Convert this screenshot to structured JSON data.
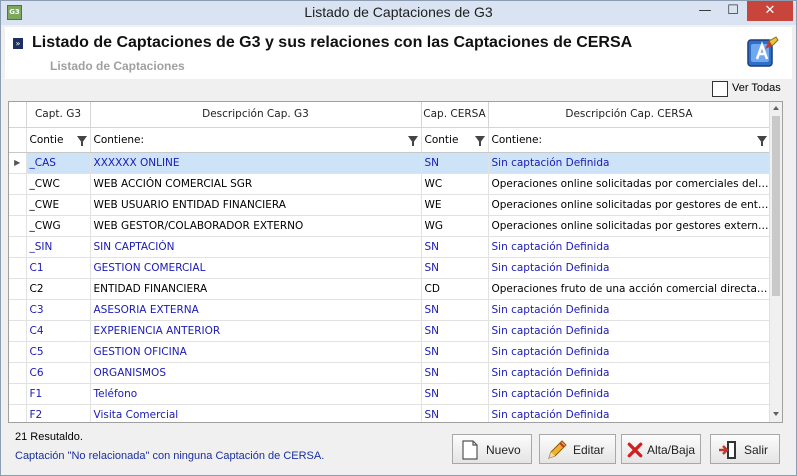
{
  "window": {
    "title": "Listado de Captaciones de G3",
    "app_icon_text": "G3",
    "min_symbol": "—",
    "max_symbol": "☐",
    "close_symbol": "✕"
  },
  "header": {
    "title": "Listado de  Captaciones de G3 y sus relaciones con las Captaciones de CERSA",
    "subtitle": "Listado de Captaciones",
    "arrow_symbol": "»"
  },
  "toggle": {
    "label": "Ver Todas",
    "checked": false
  },
  "grid": {
    "columns": [
      "Capt. G3",
      "Descripción Cap. G3",
      "Cap. CERSA",
      "Descripción Cap. CERSA"
    ],
    "filters": [
      "Contie",
      "Contiene:",
      "Contie",
      "Contiene:"
    ],
    "selected_indicator": "▶",
    "rows": [
      {
        "g3": "_CAS",
        "desc": "XXXXXX ONLINE",
        "cersa": "SN",
        "cdesc": "Sin captación Definida",
        "blue": true,
        "selected": true
      },
      {
        "g3": "_CWC",
        "desc": "WEB ACCIÓN COMERCIAL SGR",
        "cersa": "WC",
        "cdesc": "Operaciones online solicitadas por comerciales del C...",
        "blue": false
      },
      {
        "g3": "_CWE",
        "desc": "WEB USUARIO ENTIDAD FINANCIERA",
        "cersa": "WE",
        "cdesc": "Operaciones online solicitadas  por gestores de entid...",
        "blue": false
      },
      {
        "g3": "_CWG",
        "desc": "WEB GESTOR/COLABORADOR EXTERNO",
        "cersa": "WG",
        "cdesc": "Operaciones online solicitadas por gestores externos...",
        "blue": false
      },
      {
        "g3": "_SIN",
        "desc": "SIN CAPTACIÓN",
        "cersa": "SN",
        "cdesc": "Sin captación Definida",
        "blue": true
      },
      {
        "g3": "C1",
        "desc": "GESTION COMERCIAL",
        "cersa": "SN",
        "cdesc": "Sin captación Definida",
        "blue": true
      },
      {
        "g3": "C2",
        "desc": "ENTIDAD FINANCIERA",
        "cersa": "CD",
        "cdesc": "Operaciones fruto de una acción comercial directa p...",
        "blue": false
      },
      {
        "g3": "C3",
        "desc": "ASESORIA EXTERNA",
        "cersa": "SN",
        "cdesc": "Sin captación Definida",
        "blue": true
      },
      {
        "g3": "C4",
        "desc": "EXPERIENCIA ANTERIOR",
        "cersa": "SN",
        "cdesc": "Sin captación Definida",
        "blue": true
      },
      {
        "g3": "C5",
        "desc": "GESTION OFICINA",
        "cersa": "SN",
        "cdesc": "Sin captación Definida",
        "blue": true
      },
      {
        "g3": "C6",
        "desc": "ORGANISMOS",
        "cersa": "SN",
        "cdesc": "Sin captación Definida",
        "blue": true
      },
      {
        "g3": "F1",
        "desc": "Teléfono",
        "cersa": "SN",
        "cdesc": "Sin captación Definida",
        "blue": true
      },
      {
        "g3": "F2",
        "desc": "Visita Comercial",
        "cersa": "SN",
        "cdesc": "Sin captación Definida",
        "blue": true
      }
    ]
  },
  "status": {
    "count": "21 Resutaldo.",
    "legend": "Captación \"No relacionada\" con ninguna Captación de CERSA."
  },
  "buttons": {
    "nuevo": "Nuevo",
    "editar": "Editar",
    "alta_baja": "Alta/Baja",
    "salir": "Salir"
  },
  "colors": {
    "unrelated_text": "#1a1ab5",
    "selected_row": "#cde3f7",
    "close_button": "#c7453b"
  }
}
